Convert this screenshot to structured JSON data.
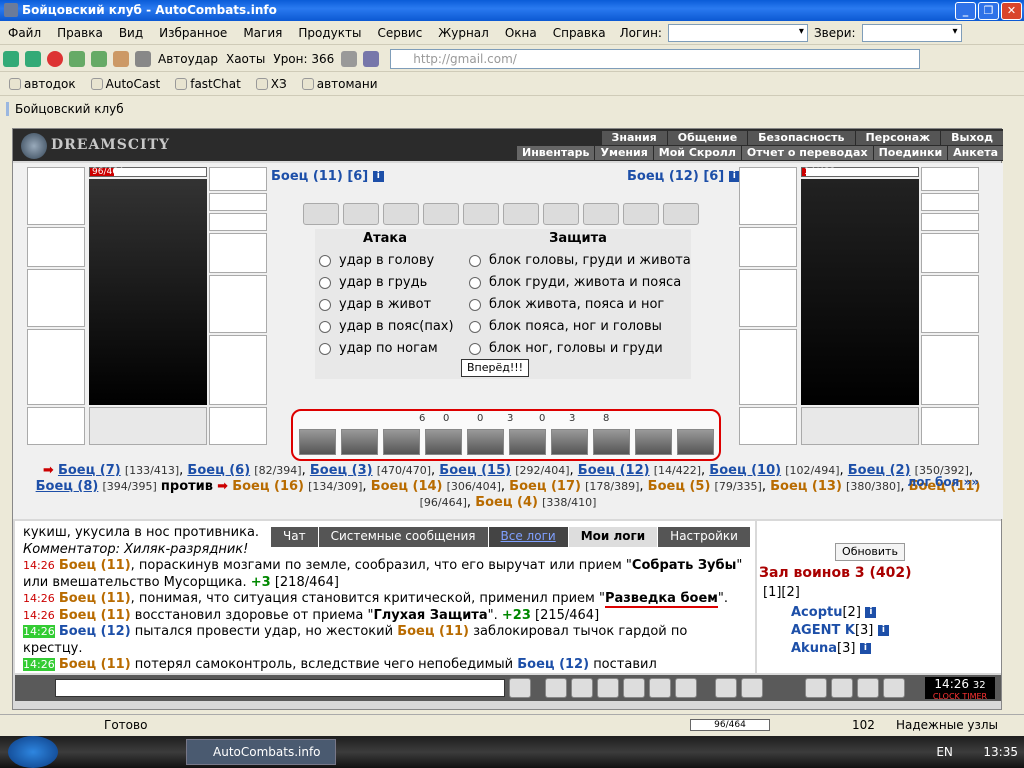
{
  "window": {
    "title": "Бойцовский клуб - AutoCombats.info"
  },
  "menu": [
    "Файл",
    "Правка",
    "Вид",
    "Избранное",
    "Магия",
    "Продукты",
    "Сервис",
    "Журнал",
    "Окна",
    "Справка"
  ],
  "login_label": "Логин:",
  "beasts_label": "Звери:",
  "toolbar": {
    "autohit": "Автоудар",
    "chaos": "Хаоты",
    "damage": "Урон: 366",
    "address": "http://gmail.com/"
  },
  "bookmarks": [
    "автодок",
    "AutoCast",
    "fastChat",
    "ХЗ",
    "автомани"
  ],
  "tab": "Бойцовский клуб",
  "nav1": [
    "Знания",
    "Общение",
    "Безопасность",
    "Персонаж",
    "Выход"
  ],
  "nav2": [
    "Инвентарь",
    "Умения",
    "Мой Скролл",
    "Отчет о переводах",
    "Поединки",
    "Анкета"
  ],
  "logo": "DREAMSCITY",
  "left": {
    "name": "Боец (11) [6]",
    "hp": "96/464",
    "hp_pct": 20.7
  },
  "right": {
    "name": "Боец (12) [6]",
    "hp": "14/422",
    "hp_pct": 3.3
  },
  "attack_title": "Атака",
  "defense_title": "Защита",
  "attacks": [
    "удар в голову",
    "удар в грудь",
    "удар в живот",
    "удар в пояс(пах)",
    "удар по ногам"
  ],
  "defenses": [
    "блок головы, груди и живота",
    "блок груди, живота и пояса",
    "блок живота, пояса и ног",
    "блок пояса, ног и головы",
    "блок ног, головы и груди"
  ],
  "go": "Вперёд!!!",
  "trick_counts": [
    "6",
    "0",
    "0",
    "3",
    "0",
    "3",
    "8"
  ],
  "teams": {
    "blue": [
      {
        "n": "Боец (7)",
        "v": "[133/413]"
      },
      {
        "n": "Боец (6)",
        "v": "[82/394]"
      },
      {
        "n": "Боец (3)",
        "v": "[470/470]"
      },
      {
        "n": "Боец (15)",
        "v": "[292/404]"
      },
      {
        "n": "Боец (12)",
        "v": "[14/422]"
      },
      {
        "n": "Боец (10)",
        "v": "[102/494]"
      },
      {
        "n": "Боец (2)",
        "v": "[350/392]"
      },
      {
        "n": "Боец (8)",
        "v": "[394/395]"
      }
    ],
    "vs": "против",
    "orange": [
      {
        "n": "Боец (16)",
        "v": "[134/309]"
      },
      {
        "n": "Боец (14)",
        "v": "[306/404]"
      },
      {
        "n": "Боец (17)",
        "v": "[178/389]"
      },
      {
        "n": "Боец (5)",
        "v": "[79/335]"
      },
      {
        "n": "Боец (13)",
        "v": "[380/380]"
      },
      {
        "n": "Боец (11)",
        "v": "[96/464]"
      },
      {
        "n": "Боец (4)",
        "v": "[338/410]"
      }
    ]
  },
  "loglink": "лог боя »»",
  "logtabs": [
    "Чат",
    "Системные сообщения",
    "Все логи",
    "Мои логи",
    "Настройки"
  ],
  "log": {
    "l0": "кукиш, укусила в нос противника.",
    "l1": "Комментатор: Хиляк-разрядник!",
    "time": "14:26",
    "f11": "Боец (11)",
    "f12": "Боец (12)",
    "l2a": ", пораскинув мозгами по земле, сообразил, что его выручат или прием \"",
    "l2b": "Собрать Зубы",
    "l2c": "\" или вмешательство Мусорщика.",
    "l2d": "+3",
    "l2e": "[218/464]",
    "l3a": ", понимая, что ситуация становится критической, применил прием \"",
    "l3b": "Разведка боем",
    "l3c": "\".",
    "l4a": "восстановил здоровье от приема \"",
    "l4b": "Глухая Защита",
    "l4c": "\".",
    "l4d": "+23",
    "l4e": "[215/464]",
    "l5a": "пытался провести удар, но жестокий",
    "l5b": "заблокировал тычок гардой по крестцу.",
    "l6a": "потерял самоконтроль, вследствие чего непобедимый",
    "l6b": "поставил"
  },
  "right_panel": {
    "refresh": "Обновить",
    "hall": "Зал воинов 3 (402)",
    "pages": "[1][2]",
    "users": [
      {
        "n": "Acoptu",
        "l": "[2]"
      },
      {
        "n": "AGENT K",
        "l": "[3]"
      },
      {
        "n": "Akuna",
        "l": "[3]"
      }
    ]
  },
  "clock": {
    "time": "14:26",
    "sec": "32",
    "label": "CLOCK TIMER"
  },
  "status": {
    "ready": "Готово",
    "hp": "96/464",
    "count": "102",
    "zone": "Надежные узлы"
  },
  "taskbar": {
    "task": "AutoCombats.info",
    "lang": "EN",
    "time": "13:35"
  }
}
